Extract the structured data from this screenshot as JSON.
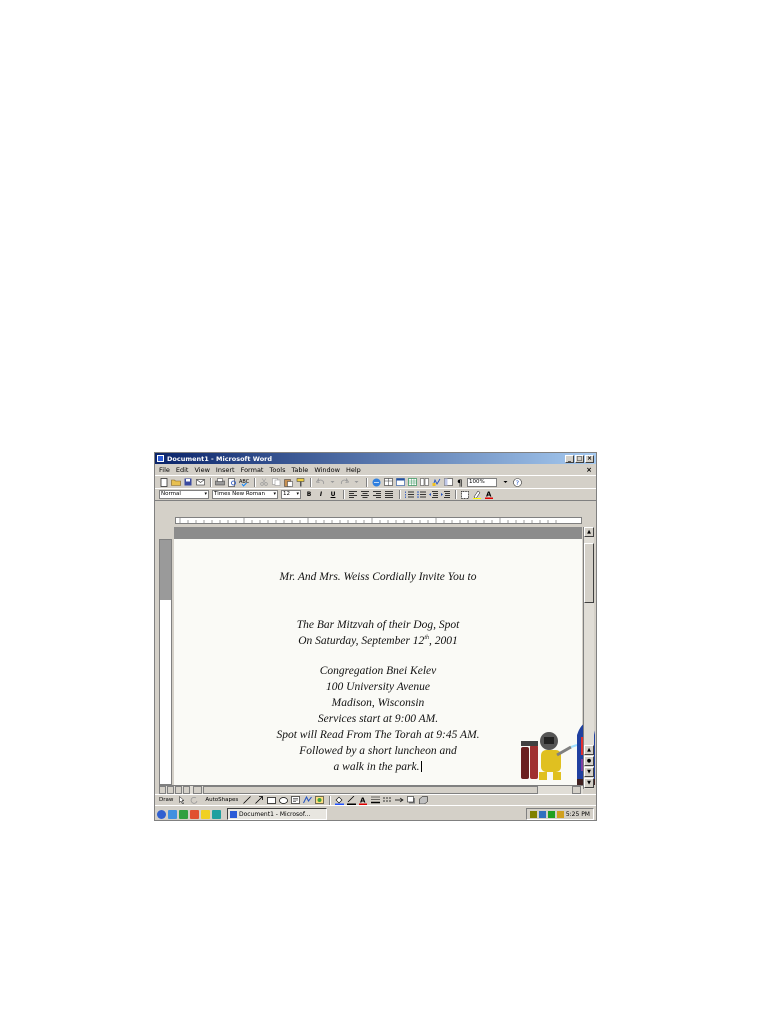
{
  "window": {
    "title": "Document1 - Microsoft Word",
    "caption_buttons": [
      "_",
      "□",
      "×"
    ]
  },
  "menubar": {
    "items": [
      "File",
      "Edit",
      "View",
      "Insert",
      "Format",
      "Tools",
      "Table",
      "Window",
      "Help"
    ],
    "close_glyph": "×"
  },
  "toolbar": {
    "zoom_value": "100%"
  },
  "formatting": {
    "style_value": "Normal",
    "font_value": "Times New Roman",
    "size_value": "12",
    "bold": "B",
    "italic": "I",
    "underline": "U",
    "font_color_glyph": "A"
  },
  "document": {
    "lines": [
      "Mr. And Mrs. Weiss Cordially Invite You to",
      "The Bar Mitzvah of their Dog, Spot",
      "On Saturday, September 12th, 2001",
      "Congregation Bnei Kelev",
      "100 University Avenue",
      "Madison, Wisconsin",
      "Services start at 9:00 AM.",
      "Spot will Read From The Torah at 9:45 AM.",
      "Followed by a short luncheon and",
      "a walk in the park."
    ],
    "date_line": {
      "before": "On Saturday, September 12",
      "sup": "th",
      "after": ", 2001"
    }
  },
  "drawbar": {
    "draw_label": "Draw",
    "autoshapes_label": "AutoShapes"
  },
  "taskbar": {
    "task_label": "Document1 - Microsof...",
    "clock": "5:25 PM"
  },
  "colors": {
    "title_active": "#0a246a",
    "chrome": "#d4d0c8",
    "page": "#fafaf6"
  },
  "icons": [
    "new-icon",
    "open-icon",
    "save-icon",
    "print-icon",
    "print-preview-icon",
    "spelling-icon",
    "cut-icon",
    "copy-icon",
    "paste-icon",
    "format-painter-icon",
    "undo-icon",
    "redo-icon",
    "hyperlink-icon",
    "tables-borders-icon",
    "insert-table-icon",
    "insert-excel-icon",
    "columns-icon",
    "drawing-icon",
    "document-map-icon",
    "show-hide-icon",
    "help-icon"
  ]
}
